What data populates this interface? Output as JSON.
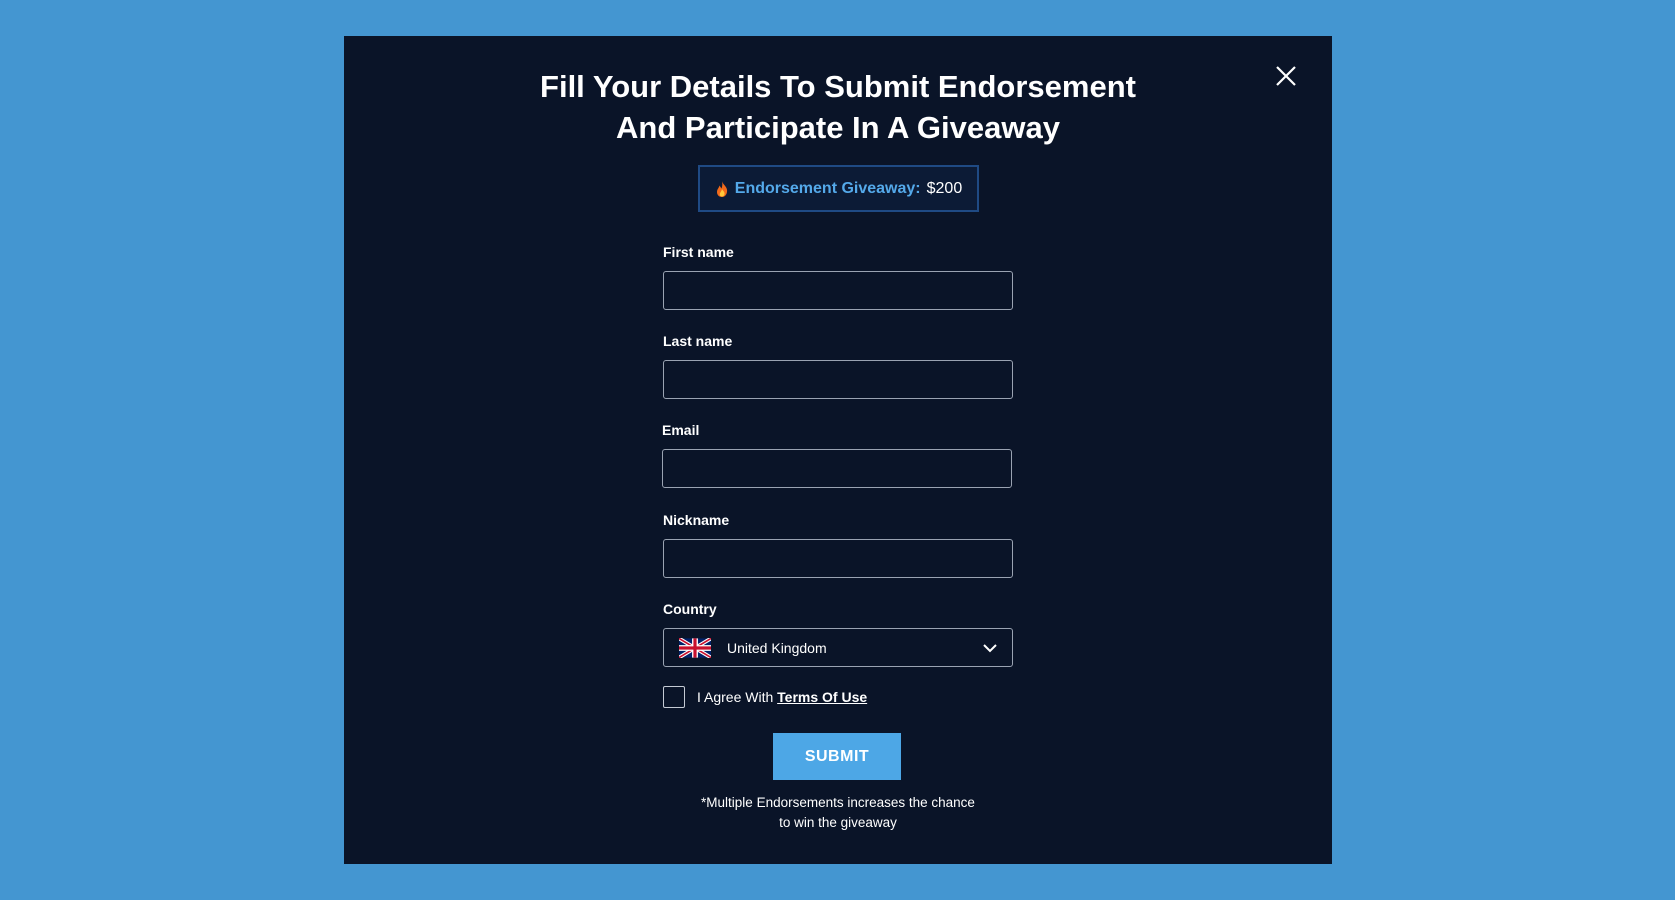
{
  "modal": {
    "title_line1": "Fill Your Details To Submit Endorsement",
    "title_line2": "And Participate In A Giveaway",
    "badge": {
      "label": "Endorsement Giveaway:",
      "amount": "$200",
      "icon": "fire-icon"
    },
    "close_icon": "close-icon"
  },
  "form": {
    "first_name": {
      "label": "First name",
      "value": "",
      "placeholder": ""
    },
    "last_name": {
      "label": "Last name",
      "value": "",
      "placeholder": ""
    },
    "email": {
      "label": "Email",
      "value": "",
      "placeholder": ""
    },
    "nickname": {
      "label": "Nickname",
      "value": "",
      "placeholder": ""
    },
    "country": {
      "label": "Country",
      "value": "United Kingdom",
      "flag": "uk-flag-icon"
    },
    "agree": {
      "text": "I Agree With",
      "link": "Terms Of Use",
      "checked": false
    },
    "submit_label": "SUBMIT"
  },
  "footnote": {
    "line1": "*Multiple Endorsements increases the chance",
    "line2": "to win the giveaway"
  },
  "colors": {
    "page_bg": "#4496d1",
    "modal_bg": "#0a1428",
    "accent": "#4da7e6",
    "badge_label": "#54a9ea"
  }
}
